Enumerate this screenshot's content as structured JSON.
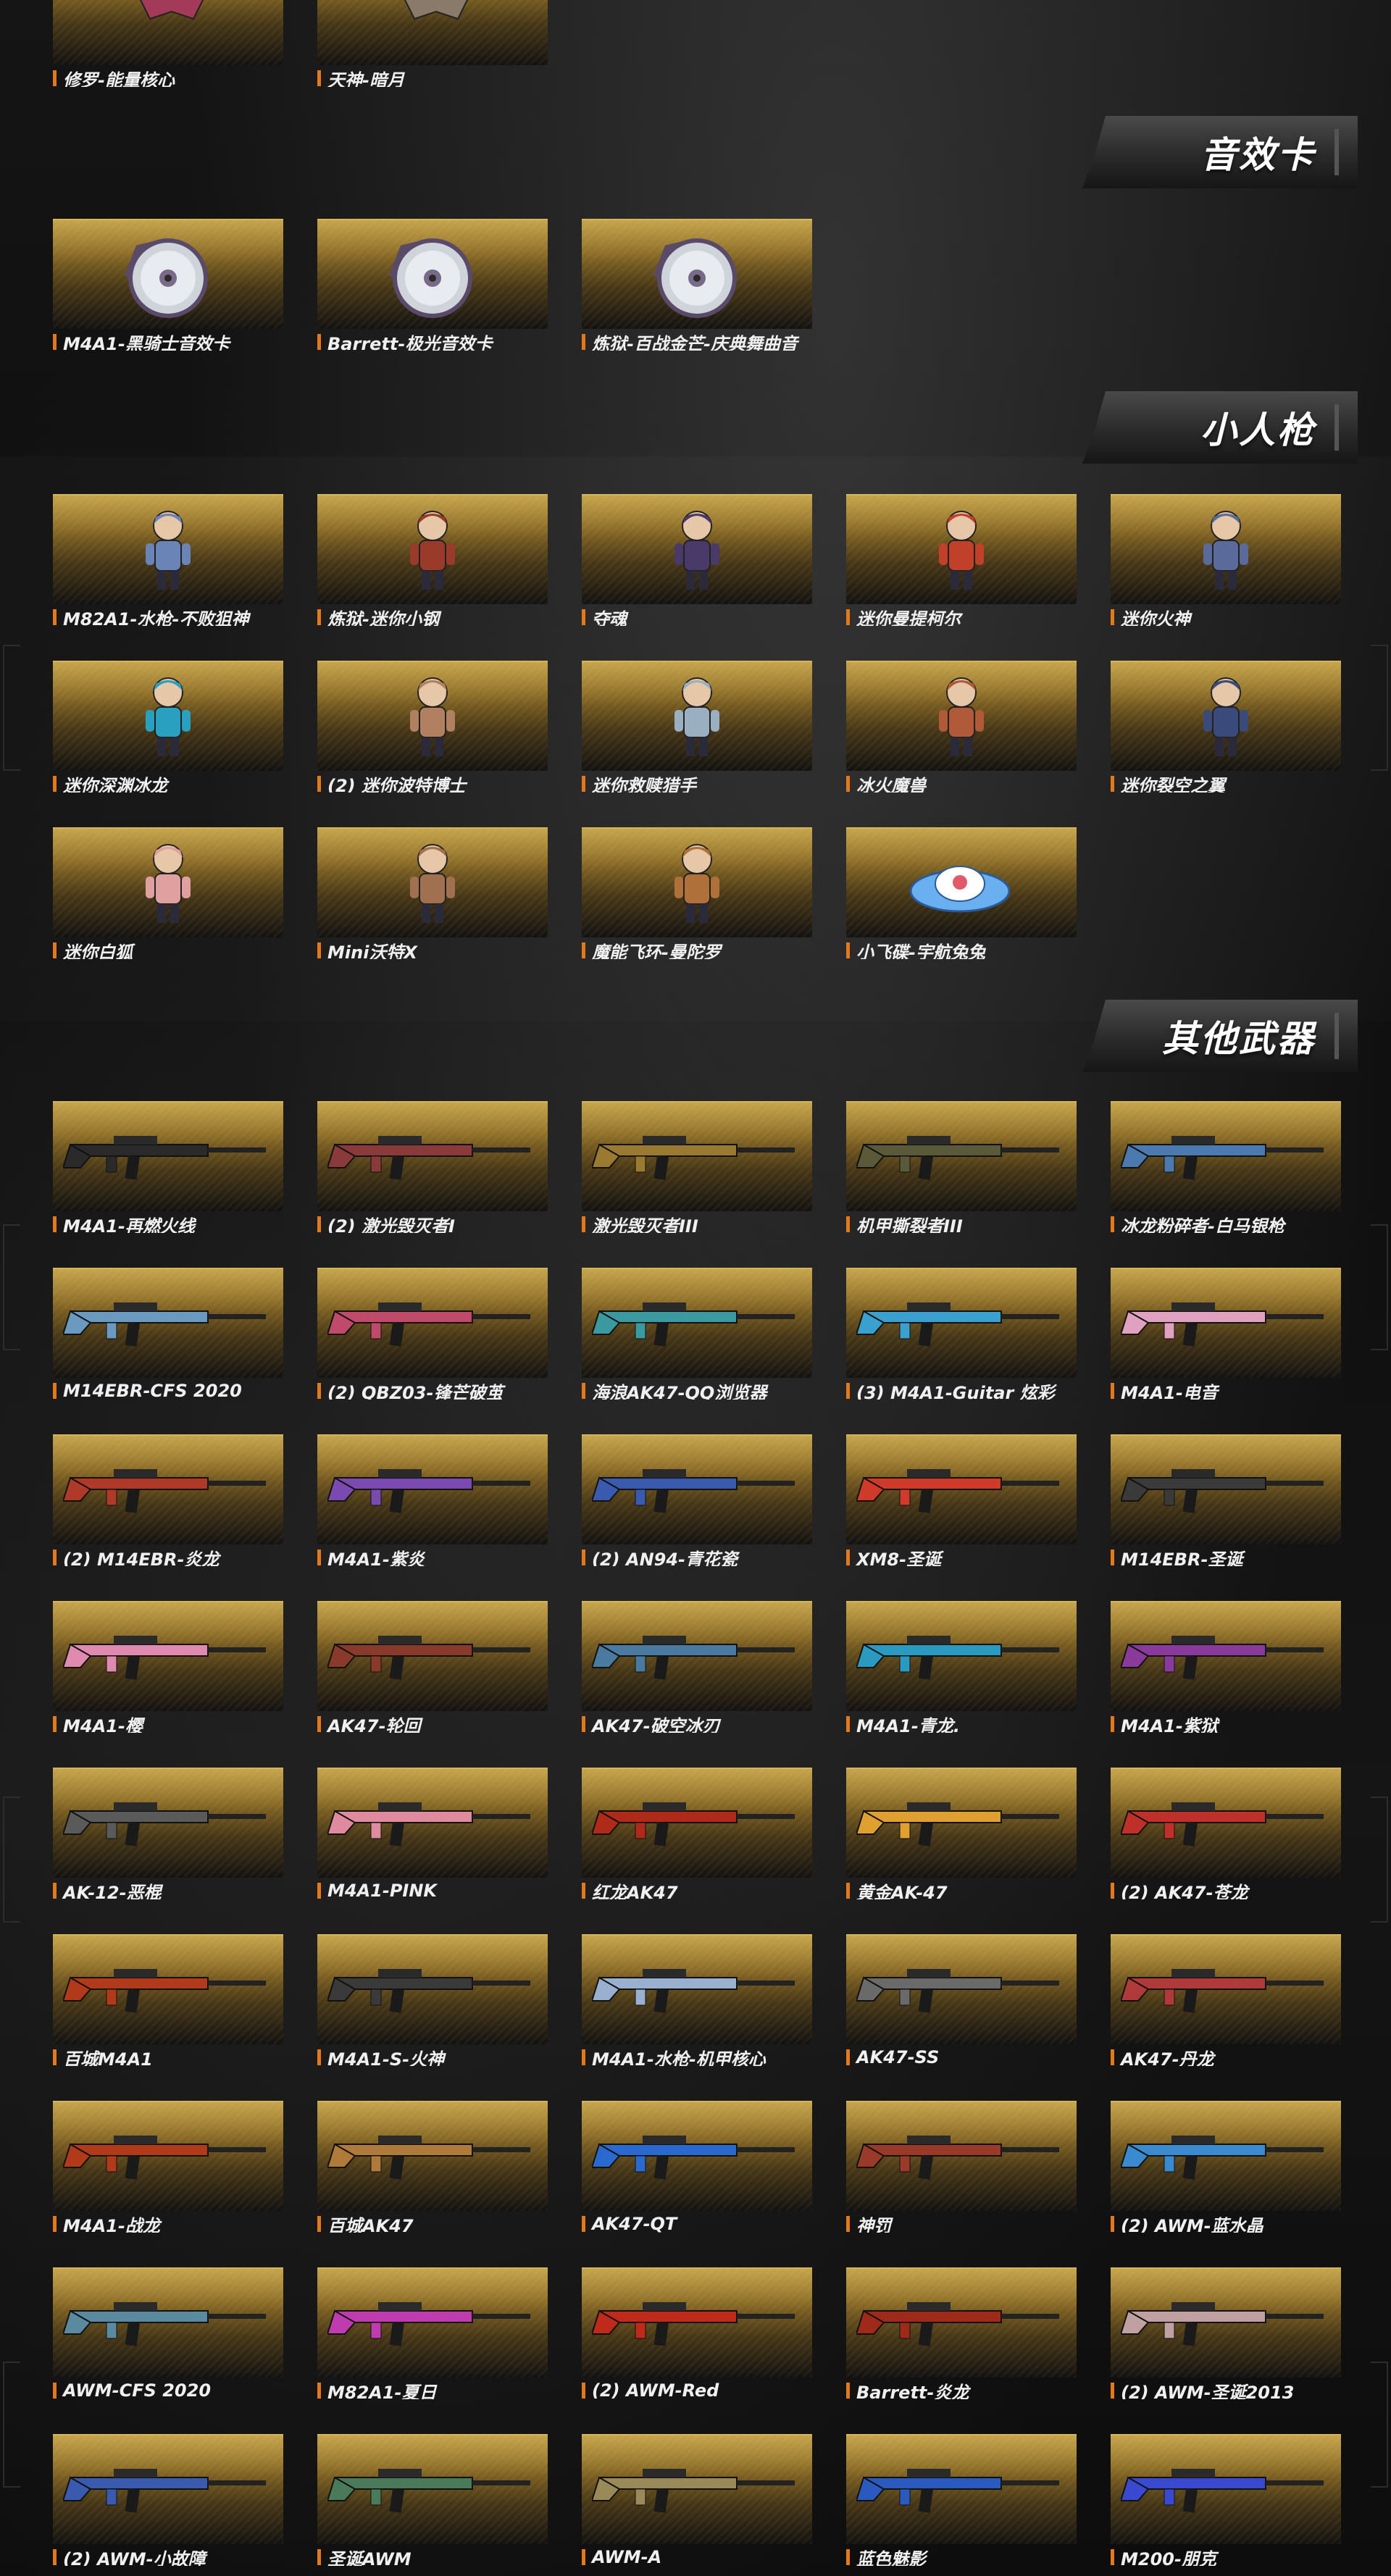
{
  "colors": {
    "accent_bar": "#e27a1c",
    "card_gold": "#b8953a",
    "label_text": "#f0f0f0",
    "section_title_text": "#ffffff"
  },
  "top_row": {
    "items": [
      {
        "label": "修罗-能量核心",
        "icon": "mecha-wings-icon",
        "color": "#a33a5a"
      },
      {
        "label": "天神-暗月",
        "icon": "mecha-figure-icon",
        "color": "#8a7a6a"
      }
    ]
  },
  "sections": {
    "sound_cards": {
      "title": "音效卡",
      "items": [
        {
          "label": "M4A1-黑骑士音效卡",
          "icon": "cd-disc-icon"
        },
        {
          "label": "Barrett-极光音效卡",
          "icon": "cd-disc-icon"
        },
        {
          "label": "炼狱-百战金芒-庆典舞曲音",
          "icon": "cd-disc-icon"
        }
      ]
    },
    "mini_figures": {
      "title": "小人枪",
      "items": [
        {
          "label": "M82A1-水枪-不败狙神",
          "icon": "mini-figure-icon",
          "color": "#6b84b8"
        },
        {
          "label": "炼狱-迷你小钢",
          "icon": "mini-figure-icon",
          "color": "#9a3a2a"
        },
        {
          "label": "夺魂",
          "icon": "mini-figure-icon",
          "color": "#4a3a6a"
        },
        {
          "label": "迷你曼提柯尔",
          "icon": "mini-figure-icon",
          "color": "#c0402a"
        },
        {
          "label": "迷你火神",
          "icon": "mini-figure-icon",
          "color": "#5a6a9a"
        },
        {
          "label": "迷你深渊冰龙",
          "icon": "mini-figure-icon",
          "color": "#2aa0c0"
        },
        {
          "label": "(2) 迷你波特博士",
          "icon": "mini-figure-icon",
          "color": "#b08060"
        },
        {
          "label": "迷你救赎猎手",
          "icon": "mini-figure-icon",
          "color": "#9ab0c0"
        },
        {
          "label": "冰火魔兽",
          "icon": "mini-figure-icon",
          "color": "#b05a3a"
        },
        {
          "label": "迷你裂空之翼",
          "icon": "mini-figure-icon",
          "color": "#3a4a7a"
        },
        {
          "label": "迷你白狐",
          "icon": "mini-figure-icon",
          "color": "#e0a0a0"
        },
        {
          "label": "Mini沃特X",
          "icon": "mini-figure-icon",
          "color": "#a07050"
        },
        {
          "label": "魔能飞环-曼陀罗",
          "icon": "mini-figure-icon",
          "color": "#b0703a"
        },
        {
          "label": "小飞碟-宇航兔兔",
          "icon": "ufo-icon",
          "color": "#6ab0f0"
        }
      ]
    },
    "other_weapons": {
      "title": "其他武器",
      "items": [
        {
          "label": "M4A1-再燃火线",
          "icon": "rifle-icon",
          "color": "#2a2a2a"
        },
        {
          "label": "(2) 激光毁灭者I",
          "icon": "rifle-icon",
          "color": "#8a3a3a"
        },
        {
          "label": "激光毁灭者III",
          "icon": "rifle-icon",
          "color": "#9a7a30"
        },
        {
          "label": "机甲撕裂者III",
          "icon": "rifle-icon",
          "color": "#5a5a3a"
        },
        {
          "label": "冰龙粉碎者-白马银枪",
          "icon": "rifle-icon",
          "color": "#4a7ab0"
        },
        {
          "label": "M14EBR-CFS 2020",
          "icon": "rifle-icon",
          "color": "#6a9ac0"
        },
        {
          "label": "(2) QBZ03-锋芒破茧",
          "icon": "rifle-icon",
          "color": "#c04a6a"
        },
        {
          "label": "海浪AK47-QQ浏览器",
          "icon": "rifle-icon",
          "color": "#3a9aa0"
        },
        {
          "label": "(3) M4A1-Guitar 炫彩",
          "icon": "rifle-icon",
          "color": "#3aa0d0"
        },
        {
          "label": "M4A1-电音",
          "icon": "rifle-icon",
          "color": "#e0a0c0"
        },
        {
          "label": "(2) M14EBR-炎龙",
          "icon": "rifle-icon",
          "color": "#b03a2a"
        },
        {
          "label": "M4A1-紫炎",
          "icon": "rifle-icon",
          "color": "#7a4ab0"
        },
        {
          "label": "(2) AN94-青花瓷",
          "icon": "rifle-icon",
          "color": "#3a5ab0"
        },
        {
          "label": "XM8-圣诞",
          "icon": "rifle-icon",
          "color": "#d03a2a"
        },
        {
          "label": "M14EBR-圣诞",
          "icon": "rifle-icon",
          "color": "#3a3a3a"
        },
        {
          "label": "M4A1-樱",
          "icon": "rifle-icon",
          "color": "#e08ab0"
        },
        {
          "label": "AK47-轮回",
          "icon": "rifle-icon",
          "color": "#8a3a2a"
        },
        {
          "label": "AK47-破空冰刃",
          "icon": "rifle-icon",
          "color": "#4a7aa0"
        },
        {
          "label": "M4A1-青龙.",
          "icon": "rifle-icon",
          "color": "#2a9ac0"
        },
        {
          "label": "M4A1-紫狱",
          "icon": "rifle-icon",
          "color": "#8a3a9a"
        },
        {
          "label": "AK-12-恶棍",
          "icon": "rifle-icon",
          "color": "#5a5a5a"
        },
        {
          "label": "M4A1-PINK",
          "icon": "rifle-icon",
          "color": "#e08aa0"
        },
        {
          "label": "红龙AK47",
          "icon": "rifle-icon",
          "color": "#b02a1a"
        },
        {
          "label": "黄金AK-47",
          "icon": "rifle-icon",
          "color": "#e0a030"
        },
        {
          "label": "(2) AK47-苍龙",
          "icon": "rifle-icon",
          "color": "#c0302a"
        },
        {
          "label": "百城M4A1",
          "icon": "rifle-icon",
          "color": "#b03a1a"
        },
        {
          "label": "M4A1-S-火神",
          "icon": "rifle-icon",
          "color": "#3a3a3a"
        },
        {
          "label": "M4A1-水枪-机甲核心",
          "icon": "rifle-icon",
          "color": "#9ab0d0"
        },
        {
          "label": "AK47-SS",
          "icon": "rifle-icon",
          "color": "#6a6a6a"
        },
        {
          "label": "AK47-丹龙",
          "icon": "rifle-icon",
          "color": "#b03a3a"
        },
        {
          "label": "M4A1-战龙",
          "icon": "rifle-icon",
          "color": "#b03a1a"
        },
        {
          "label": "百城AK47",
          "icon": "rifle-icon",
          "color": "#b07a3a"
        },
        {
          "label": "AK47-QT",
          "icon": "rifle-icon",
          "color": "#2a6ad0"
        },
        {
          "label": "神罚",
          "icon": "rifle-icon",
          "color": "#9a3a2a"
        },
        {
          "label": "(2) AWM-蓝水晶",
          "icon": "rifle-icon",
          "color": "#3a8ad0"
        },
        {
          "label": "AWM-CFS 2020",
          "icon": "rifle-icon",
          "color": "#5a8aa0"
        },
        {
          "label": "M82A1-夏日",
          "icon": "rifle-icon",
          "color": "#c03ab0"
        },
        {
          "label": "(2) AWM-Red",
          "icon": "rifle-icon",
          "color": "#c02a1a"
        },
        {
          "label": "Barrett-炎龙",
          "icon": "rifle-icon",
          "color": "#a02a1a"
        },
        {
          "label": "(2) AWM-圣诞2013",
          "icon": "rifle-icon",
          "color": "#c0a0a0"
        },
        {
          "label": "(2) AWM-小故障",
          "icon": "rifle-icon",
          "color": "#3a5ab0"
        },
        {
          "label": "圣诞AWM",
          "icon": "rifle-icon",
          "color": "#4a7a5a"
        },
        {
          "label": "AWM-A",
          "icon": "rifle-icon",
          "color": "#9a8a5a"
        },
        {
          "label": "蓝色魅影",
          "icon": "rifle-icon",
          "color": "#2a5ac0"
        },
        {
          "label": "M200-朋克",
          "icon": "rifle-icon",
          "color": "#3a4ad0"
        }
      ]
    }
  }
}
